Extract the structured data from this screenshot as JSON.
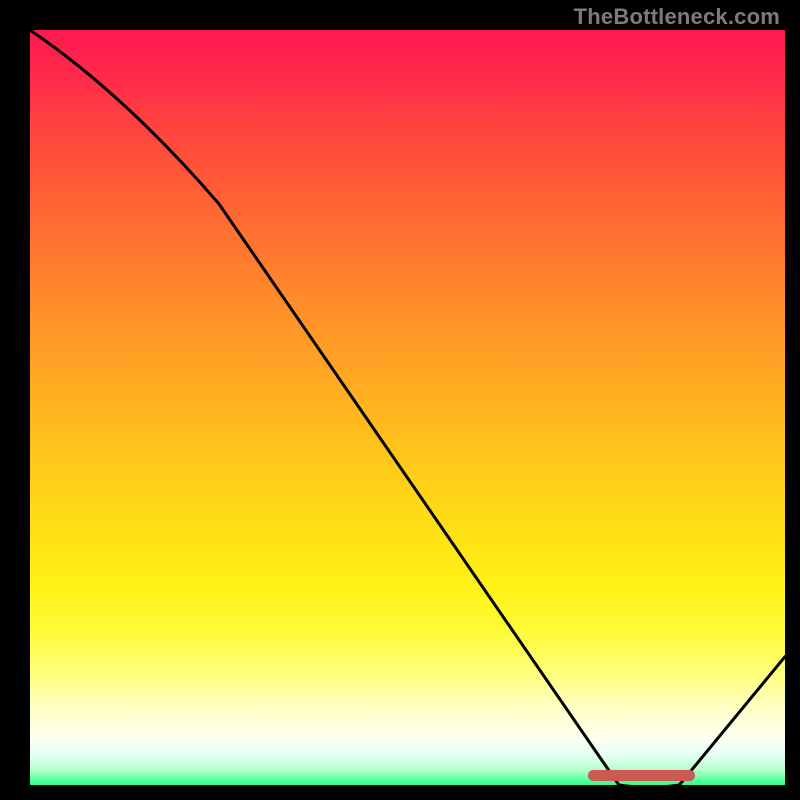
{
  "watermark": "TheBottleneck.com",
  "chart_data": {
    "type": "line",
    "title": "",
    "xlabel": "",
    "ylabel": "",
    "xlim": [
      0,
      100
    ],
    "ylim": [
      0,
      100
    ],
    "x": [
      0,
      25,
      78,
      86,
      100
    ],
    "values": [
      100,
      77,
      0,
      0,
      17
    ],
    "gradient_stops": [
      {
        "pos": 0,
        "color": "#ff1850"
      },
      {
        "pos": 50,
        "color": "#ffba1e"
      },
      {
        "pos": 80,
        "color": "#fffb3c"
      },
      {
        "pos": 100,
        "color": "#2dff89"
      }
    ],
    "marker": {
      "x_start": 74,
      "x_end": 88,
      "y": 1.2,
      "color": "#cc5a52"
    }
  }
}
